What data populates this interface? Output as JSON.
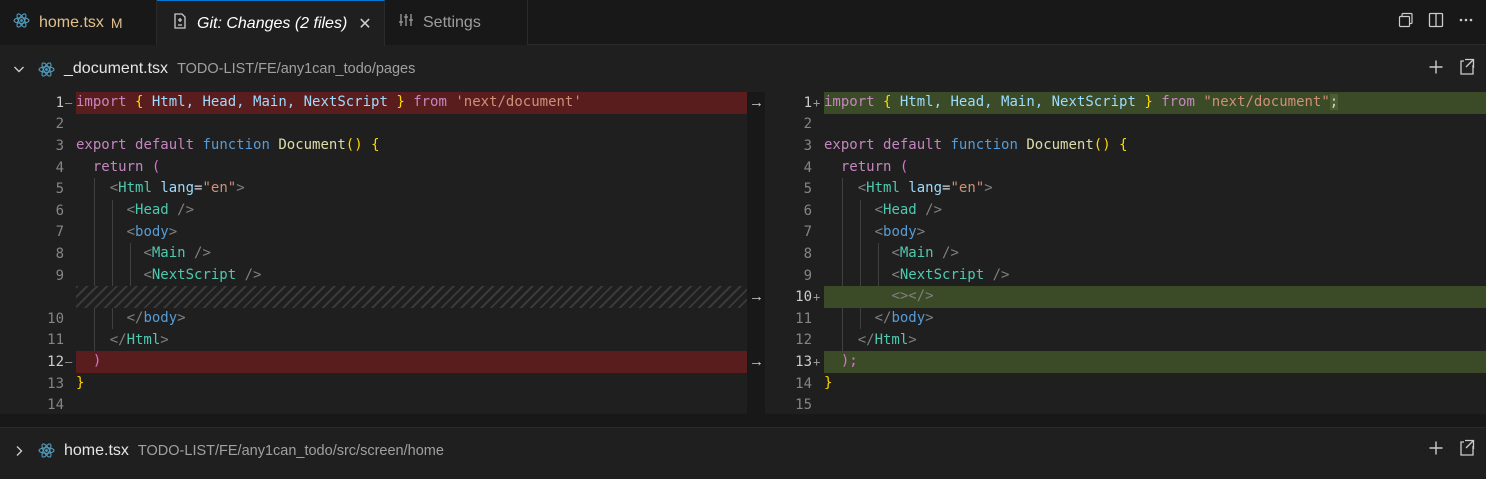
{
  "tabs": [
    {
      "label": "home.tsx",
      "badge": "M"
    },
    {
      "label": "Git: Changes (2 files)",
      "close": "✕"
    },
    {
      "label": "Settings"
    }
  ],
  "files": [
    {
      "name": "_document.tsx",
      "path": "TODO-LIST/FE/any1can_todo/pages",
      "expanded": true
    },
    {
      "name": "home.tsx",
      "path": "TODO-LIST/FE/any1can_todo/src/screen/home",
      "expanded": false
    }
  ],
  "left_lines": [
    "1",
    "2",
    "3",
    "4",
    "5",
    "6",
    "7",
    "8",
    "9",
    "10",
    "11",
    "12",
    "13",
    "14"
  ],
  "right_lines": [
    "1",
    "2",
    "3",
    "4",
    "5",
    "6",
    "7",
    "8",
    "9",
    "10",
    "11",
    "12",
    "13",
    "14",
    "15"
  ],
  "markers": {
    "removed": "—",
    "added": "+"
  },
  "code": {
    "import_kw": "import",
    "open_brace": "{",
    "import_names": " Html, Head, Main, NextScript ",
    "close_brace": "}",
    "from_kw": "from",
    "module_left": "'next/document'",
    "module_right": "\"next/document\"",
    "semicolon": ";",
    "export_kw": "export",
    "default_kw": "default",
    "function_kw": "function",
    "fn_name": "Document",
    "parens": "()",
    "return_kw": "return",
    "open_paren": "(",
    "close_paren": ")",
    "close_paren_semi": ");",
    "lt": "<",
    "gt": ">",
    "lt_slash": "</",
    "self_close": " />",
    "html_tag": "Html",
    "lang_attr": "lang",
    "eq": "=",
    "lang_val": "\"en\"",
    "head_tag": "Head",
    "body_tag": "body",
    "main_tag": "Main",
    "nextscript_tag": "NextScript",
    "fragment": "<></>"
  },
  "colors": {
    "accent": "#0078d4",
    "removed": "#7a2424",
    "added": "#4b5e2f",
    "modified": "#e2c08d"
  },
  "icons": [
    "react-icon",
    "git-compare-icon",
    "settings-icon",
    "close-icon",
    "chevron-down-icon",
    "chevron-right-icon",
    "split-view-icon",
    "layout-icon",
    "more-icon",
    "plus-icon",
    "open-file-icon",
    "arrow-right-icon"
  ]
}
